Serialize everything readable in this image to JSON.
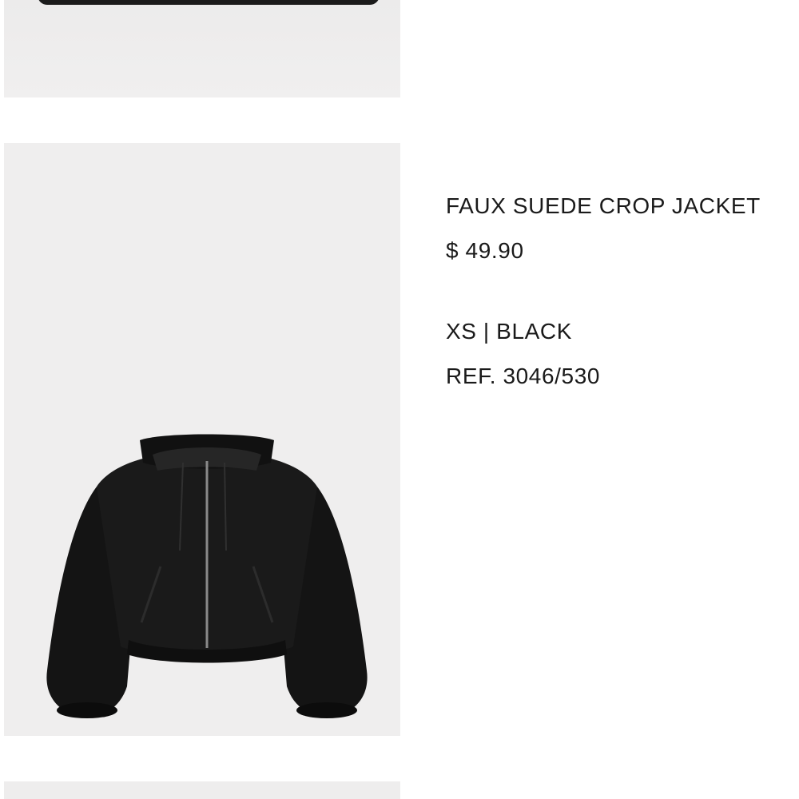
{
  "product": {
    "name": "FAUX SUEDE CROP JACKET",
    "price": "$ 49.90",
    "variant": "XS | BLACK",
    "reference": "REF. 3046/530"
  }
}
